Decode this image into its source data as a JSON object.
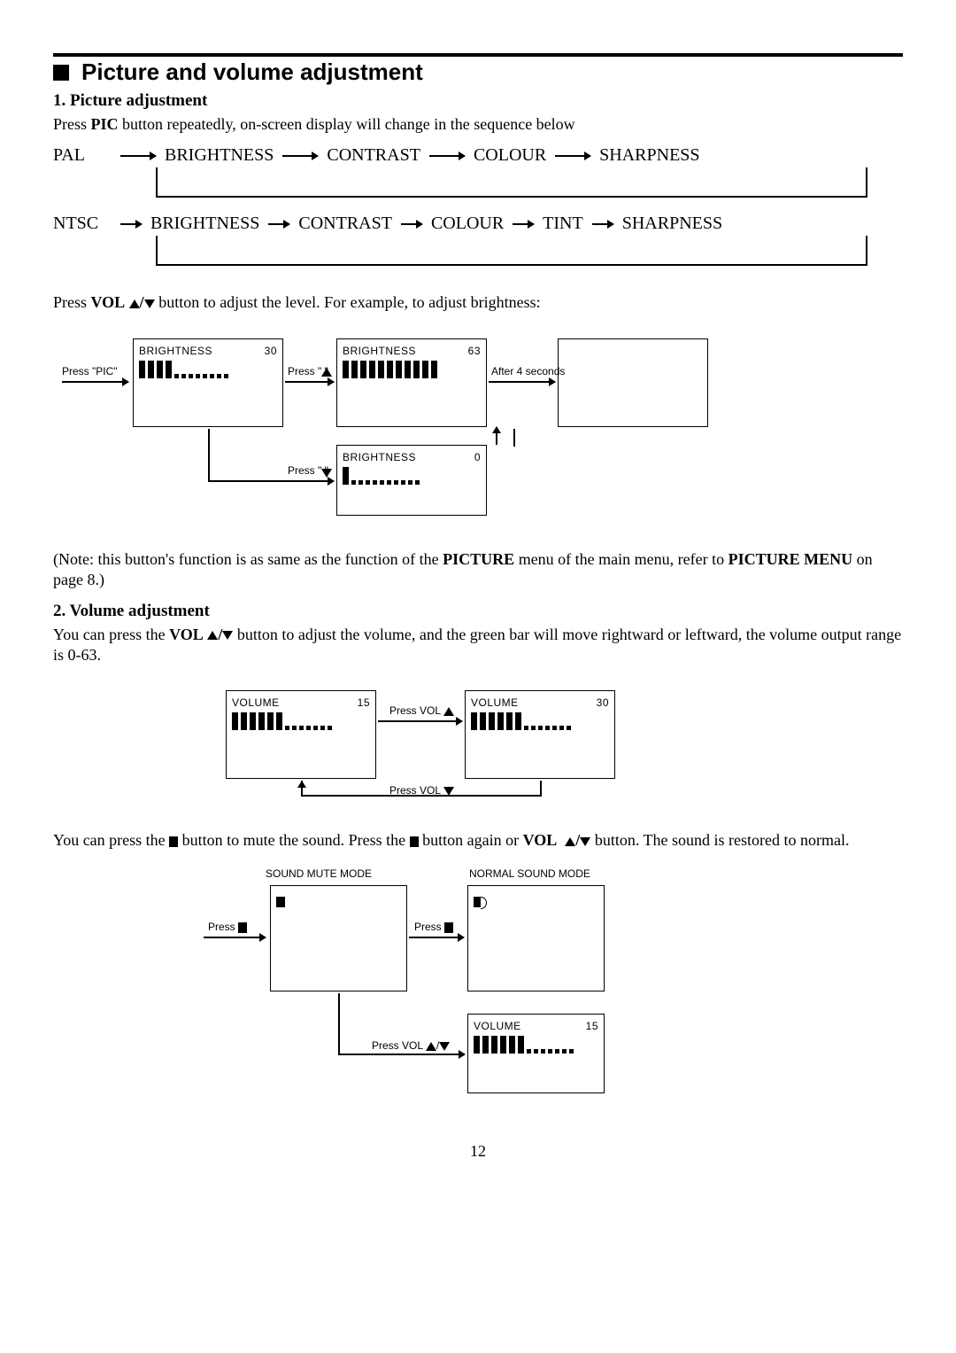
{
  "page_number": "12",
  "heading": "Picture and volume adjustment",
  "section1": {
    "title": "1. Picture adjustment",
    "intro_pre": "Press ",
    "intro_bold": "PIC",
    "intro_post": " button repeatedly, on-screen display will change in the sequence below",
    "seq_pal_label": "PAL",
    "seq_pal_items": [
      "BRIGHTNESS",
      "CONTRAST",
      "COLOUR",
      "SHARPNESS"
    ],
    "seq_ntsc_label": "NTSC",
    "seq_ntsc_items": [
      "BRIGHTNESS",
      "CONTRAST",
      "COLOUR",
      "TINT",
      "SHARPNESS"
    ],
    "adjust_pre": "Press ",
    "adjust_bold": "VOL",
    "adjust_post": " button to adjust the level. For example, to adjust brightness:",
    "diagram": {
      "press_pic": "Press \"PIC\"",
      "press_up": "Press \"   \"",
      "press_down": "Press \"   \"",
      "after4": "After 4 seconds",
      "box1_label": "BRIGHTNESS",
      "box1_val": "30",
      "box2_label": "BRIGHTNESS",
      "box2_val": "63",
      "box3_label": "BRIGHTNESS",
      "box3_val": "0"
    },
    "note_pre": "(Note: this button's function is as same as the function of the ",
    "note_b1": "PICTURE",
    "note_mid": " menu of the main menu, refer to ",
    "note_b2": "PICTURE MENU",
    "note_post": " on  page 8.)"
  },
  "section2": {
    "title": "2. Volume adjustment",
    "p1_pre": "You can press the ",
    "p1_bold": "VOL",
    "p1_post": " button to adjust the volume, and the green bar will move rightward or leftward, the volume output range is 0-63.",
    "vol_diag": {
      "press_vol_up": "Press VOL",
      "press_vol_down": "Press VOL",
      "box1_label": "VOLUME",
      "box1_val": "15",
      "box2_label": "VOLUME",
      "box2_val": "30"
    },
    "p2_a": "You can press the ",
    "p2_b": " button to mute the sound. Press the ",
    "p2_c": " button again or ",
    "p2_bold": "VOL",
    "p2_d": " button. The sound is restored to normal.",
    "mute_diag": {
      "h1": "SOUND MUTE MODE",
      "h2": "NORMAL SOUND MODE",
      "press": "Press",
      "press_vol": "Press VOL",
      "box_label": "VOLUME",
      "box_val": "15"
    }
  }
}
